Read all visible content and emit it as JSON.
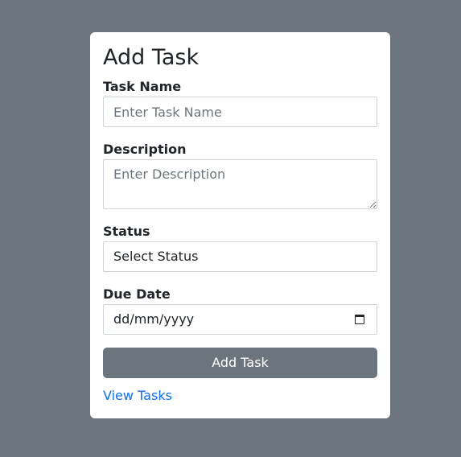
{
  "form": {
    "title": "Add Task",
    "task_name": {
      "label": "Task Name",
      "placeholder": "Enter Task Name"
    },
    "description": {
      "label": "Description",
      "placeholder": "Enter Description"
    },
    "status": {
      "label": "Status",
      "selected": "Select Status"
    },
    "due_date": {
      "label": "Due Date",
      "value": "dd/mm/yyyy",
      "icon": "calendar-icon"
    },
    "submit_label": "Add Task",
    "view_link": "View Tasks"
  },
  "colors": {
    "background": "#6c757d",
    "card": "#ffffff",
    "button": "#6c757d",
    "link": "#0d6efd"
  }
}
